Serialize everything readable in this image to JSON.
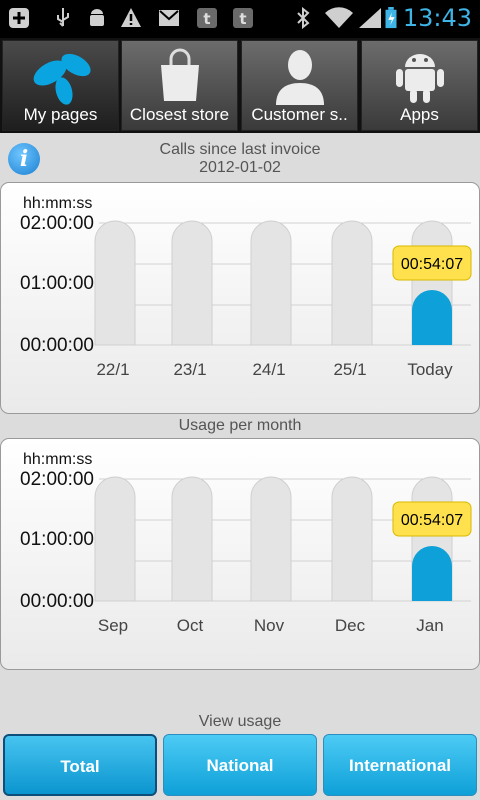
{
  "status_bar": {
    "time": "13:43"
  },
  "nav": {
    "tabs": [
      {
        "label": "My pages",
        "icon": "telenor-logo-icon",
        "active": true
      },
      {
        "label": "Closest store",
        "icon": "shopping-bag-icon",
        "active": false
      },
      {
        "label": "Customer s..",
        "icon": "person-icon",
        "active": false
      },
      {
        "label": "Apps",
        "icon": "android-icon",
        "active": false
      }
    ]
  },
  "calls_section": {
    "title": "Calls since last invoice",
    "date": "2012-01-02"
  },
  "usage_section": {
    "title": "Usage per month"
  },
  "colors": {
    "accent": "#0ea0d8",
    "tooltip": "#ffe14d",
    "bar_bg": "#e4e4e4"
  },
  "chart_data": [
    {
      "type": "bar",
      "unit": "hh:mm:ss",
      "y_ticks": [
        "02:00:00",
        "01:00:00",
        "00:00:00"
      ],
      "ylim_seconds": [
        0,
        7200
      ],
      "categories": [
        "22/1",
        "23/1",
        "24/1",
        "25/1",
        "Today"
      ],
      "values_seconds": [
        0,
        0,
        0,
        0,
        3247
      ],
      "highlight_label": "00:54:07"
    },
    {
      "type": "bar",
      "unit": "hh:mm:ss",
      "y_ticks": [
        "02:00:00",
        "01:00:00",
        "00:00:00"
      ],
      "ylim_seconds": [
        0,
        7200
      ],
      "categories": [
        "Sep",
        "Oct",
        "Nov",
        "Dec",
        "Jan"
      ],
      "values_seconds": [
        0,
        0,
        0,
        0,
        3247
      ],
      "highlight_label": "00:54:07"
    }
  ],
  "view_usage": {
    "title": "View usage",
    "buttons": [
      {
        "label": "Total",
        "active": true
      },
      {
        "label": "National",
        "active": false
      },
      {
        "label": "International",
        "active": false
      }
    ]
  }
}
